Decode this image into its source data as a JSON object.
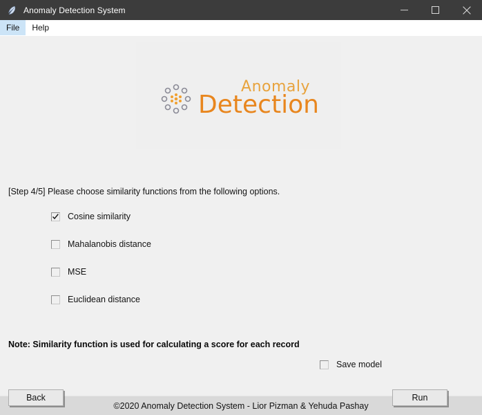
{
  "window": {
    "title": "Anomaly Detection System",
    "icon": "feather-icon",
    "controls": [
      {
        "name": "minimize-button",
        "glyph": "minimize-icon"
      },
      {
        "name": "maximize-button",
        "glyph": "maximize-icon"
      },
      {
        "name": "close-button",
        "glyph": "close-icon"
      }
    ]
  },
  "menubar": {
    "items": [
      {
        "label": "File",
        "active": true
      },
      {
        "label": "Help",
        "active": false
      }
    ]
  },
  "logo": {
    "word_top": "Anomaly",
    "word_bottom": "Detection",
    "mark": "dots-cluster-icon",
    "color_top": "#e8a33d",
    "color_bottom": "#e8861e",
    "dot_gray": "#8a8a96",
    "dot_orange": "#f0a030"
  },
  "main": {
    "step_text": "[Step 4/5] Please choose similarity functions from the following options.",
    "options": [
      {
        "label": "Cosine similarity",
        "checked": true
      },
      {
        "label": "Mahalanobis distance",
        "checked": false
      },
      {
        "label": "MSE",
        "checked": false
      },
      {
        "label": "Euclidean distance",
        "checked": false
      }
    ],
    "note": "Note: Similarity function is used for calculating a score for each record",
    "save_model": {
      "label": "Save model",
      "checked": false
    },
    "buttons": {
      "back": "Back",
      "run": "Run"
    }
  },
  "footer": {
    "text": "©2020 Anomaly Detection System - Lior Pizman & Yehuda Pashay"
  }
}
